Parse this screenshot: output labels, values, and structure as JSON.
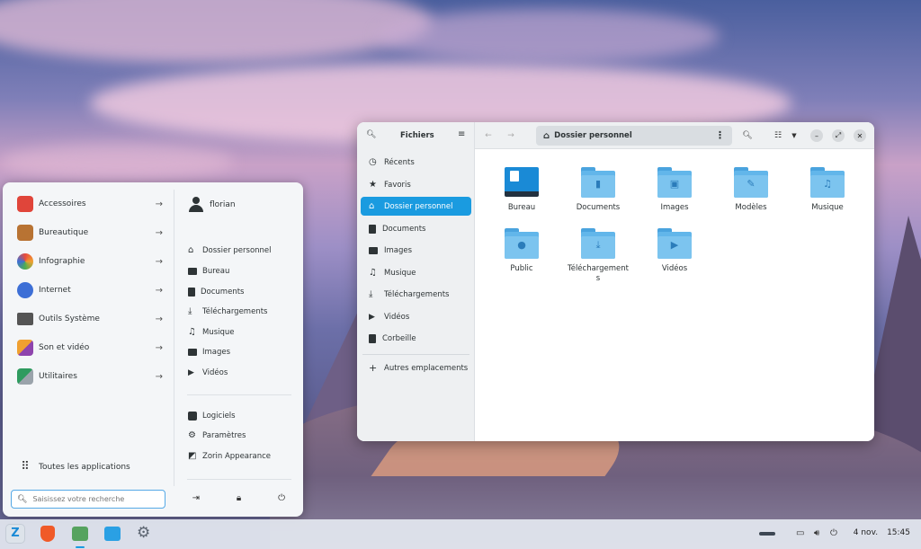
{
  "menu": {
    "categories": [
      {
        "label": "Accessoires",
        "icon": "toolbox-icon",
        "color": "#e0453a"
      },
      {
        "label": "Bureautique",
        "icon": "briefcase-icon",
        "color": "#b87333"
      },
      {
        "label": "Infographie",
        "icon": "graphics-icon",
        "color": "#f0a030"
      },
      {
        "label": "Internet",
        "icon": "globe-icon",
        "color": "#3d6fd6"
      },
      {
        "label": "Outils Système",
        "icon": "monitor-icon",
        "color": "#555555"
      },
      {
        "label": "Son et vidéo",
        "icon": "music-video-icon",
        "color": "#8e44ad"
      },
      {
        "label": "Utilitaires",
        "icon": "utilities-icon",
        "color": "#2e9b5f"
      }
    ],
    "all_apps_label": "Toutes les applications",
    "search_placeholder": "Saisissez votre recherche",
    "user_name": "florian",
    "places": [
      {
        "label": "Dossier personnel",
        "icon": "home-icon"
      },
      {
        "label": "Bureau",
        "icon": "desktop-icon"
      },
      {
        "label": "Documents",
        "icon": "document-icon"
      },
      {
        "label": "Téléchargements",
        "icon": "download-icon"
      },
      {
        "label": "Musique",
        "icon": "music-icon"
      },
      {
        "label": "Images",
        "icon": "image-icon"
      },
      {
        "label": "Vidéos",
        "icon": "video-icon"
      }
    ],
    "system": [
      {
        "label": "Logiciels",
        "icon": "software-icon"
      },
      {
        "label": "Paramètres",
        "icon": "settings-icon"
      },
      {
        "label": "Zorin Appearance",
        "icon": "appearance-icon"
      }
    ]
  },
  "files": {
    "title": "Fichiers",
    "path": "Dossier personnel",
    "sidebar": [
      {
        "label": "Récents",
        "icon": "clock-icon",
        "active": false
      },
      {
        "label": "Favoris",
        "icon": "star-icon",
        "active": false
      },
      {
        "label": "Dossier personnel",
        "icon": "home-icon",
        "active": true
      },
      {
        "label": "Documents",
        "icon": "document-icon",
        "active": false
      },
      {
        "label": "Images",
        "icon": "image-icon",
        "active": false
      },
      {
        "label": "Musique",
        "icon": "music-icon",
        "active": false
      },
      {
        "label": "Téléchargements",
        "icon": "download-icon",
        "active": false
      },
      {
        "label": "Vidéos",
        "icon": "video-icon",
        "active": false
      },
      {
        "label": "Corbeille",
        "icon": "trash-icon",
        "active": false
      }
    ],
    "other_locations": "Autres emplacements",
    "folders": [
      {
        "label": "Bureau",
        "icon": "desktop-folder-icon"
      },
      {
        "label": "Documents",
        "icon": "documents-folder-icon"
      },
      {
        "label": "Images",
        "icon": "images-folder-icon"
      },
      {
        "label": "Modèles",
        "icon": "templates-folder-icon"
      },
      {
        "label": "Musique",
        "icon": "music-folder-icon"
      },
      {
        "label": "Public",
        "icon": "public-folder-icon"
      },
      {
        "label": "Téléchargements",
        "icon": "downloads-folder-icon"
      },
      {
        "label": "Vidéos",
        "icon": "videos-folder-icon"
      }
    ]
  },
  "taskbar": {
    "date": "4 nov.",
    "time": "15:45"
  },
  "colors": {
    "accent": "#1a9be0",
    "folder": "#62b6ea"
  }
}
